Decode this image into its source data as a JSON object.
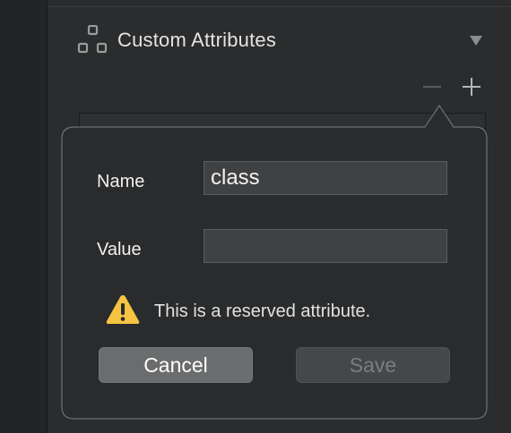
{
  "section": {
    "title": "Custom Attributes",
    "icon": "attributes-icon"
  },
  "table_controls": {
    "remove_icon": "minus-icon",
    "add_icon": "plus-icon"
  },
  "popover": {
    "name_label": "Name",
    "name_value": "class",
    "value_label": "Value",
    "value_value": "",
    "warning_icon": "warning-icon",
    "warning_text": "This is a reserved attribute.",
    "cancel_label": "Cancel",
    "save_label": "Save",
    "save_enabled": false
  },
  "colors": {
    "background": "#2b2c2d",
    "popover_fill": "#2a2b2c",
    "warning_yellow": "#f6c343",
    "cancel_button": "#6b6c6d",
    "save_button_disabled": "#464748"
  }
}
